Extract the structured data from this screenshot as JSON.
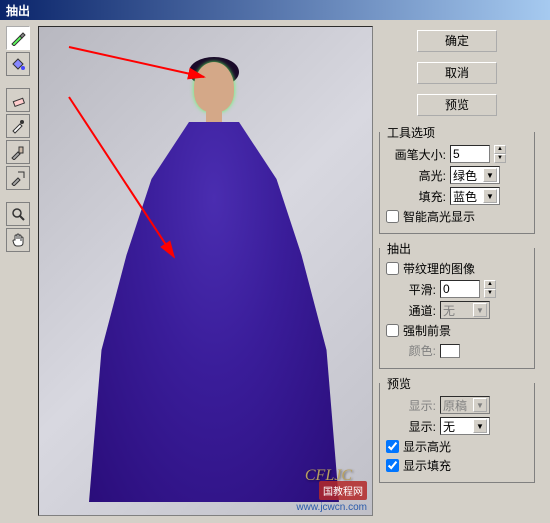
{
  "title": "抽出",
  "buttons": {
    "ok": "确定",
    "cancel": "取消",
    "preview": "预览"
  },
  "groups": {
    "tool_options": {
      "title": "工具选项",
      "brush_size_label": "画笔大小:",
      "brush_size_value": "5",
      "highlight_label": "高光:",
      "highlight_value": "绿色",
      "fill_label": "填充:",
      "fill_value": "蓝色",
      "smart_highlight": "智能高光显示"
    },
    "extract": {
      "title": "抽出",
      "textured_image": "带纹理的图像",
      "smooth_label": "平滑:",
      "smooth_value": "0",
      "channel_label": "通道:",
      "channel_value": "无",
      "force_foreground": "强制前景",
      "color_label": "颜色:"
    },
    "preview": {
      "title": "预览",
      "show_label": "显示:",
      "show_value": "原稿",
      "display_label": "显示:",
      "display_value": "无",
      "show_highlight": "显示高光",
      "show_fill": "显示填充"
    }
  },
  "watermark": "CFLJC",
  "badge": "国教程网",
  "url": "www.jcwcn.com",
  "icons": {
    "highlighter": "highlighter-icon",
    "fill": "fill-icon",
    "eraser": "eraser-icon",
    "eyedropper": "eyedropper-icon",
    "cleanup": "cleanup-icon",
    "edge": "edge-icon",
    "zoom": "zoom-icon",
    "hand": "hand-icon"
  }
}
